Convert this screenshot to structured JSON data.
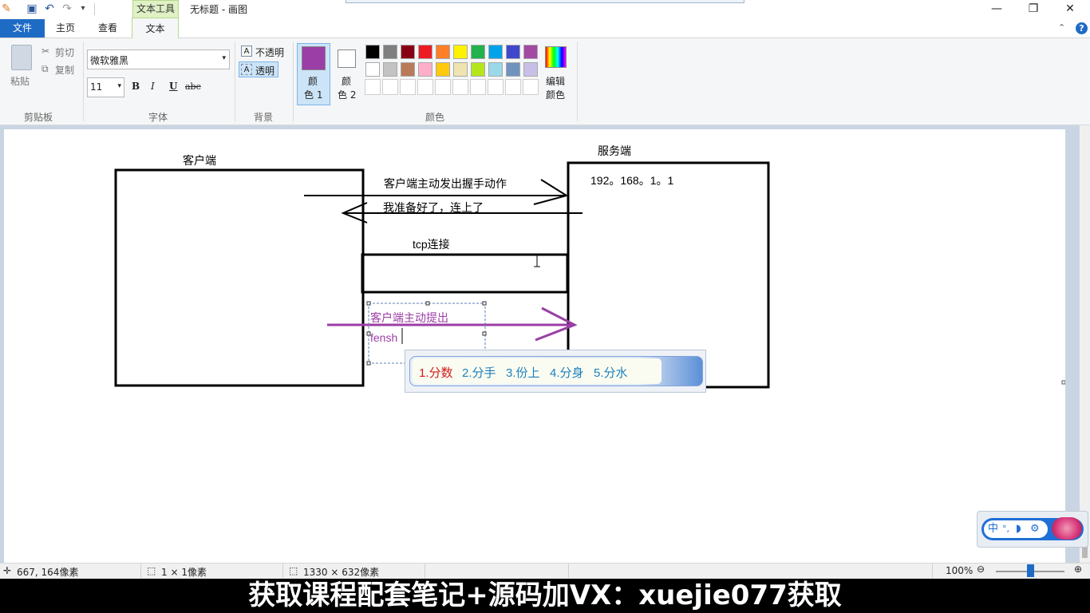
{
  "titlebar": {
    "window_title": "无标题 - 画图",
    "context_tab": "文本工具"
  },
  "tabs": {
    "file": "文件",
    "home": "主页",
    "view": "查看",
    "text": "文本"
  },
  "ribbon": {
    "clipboard": {
      "paste": "粘贴",
      "cut": "剪切",
      "copy": "复制",
      "group_label": "剪贴板"
    },
    "font": {
      "family": "微软雅黑",
      "size": "11",
      "bold": "B",
      "italic": "I",
      "underline": "U",
      "strike": "abc",
      "group_label": "字体"
    },
    "background": {
      "opaque": "不透明",
      "transparent": "透明",
      "group_label": "背景"
    },
    "colors": {
      "color1_label_a": "颜",
      "color1_label_b": "色 1",
      "color2_label_a": "颜",
      "color2_label_b": "色 2",
      "color1_value": "#9b3ea5",
      "color2_value": "#ffffff",
      "edit_a": "编辑",
      "edit_b": "颜色",
      "group_label": "颜色",
      "palette_row1": [
        "#000000",
        "#7f7f7f",
        "#880015",
        "#ed1c24",
        "#ff7f27",
        "#fff200",
        "#22b14c",
        "#00a2e8",
        "#3f48cc",
        "#a349a4"
      ],
      "palette_row2": [
        "#ffffff",
        "#c3c3c3",
        "#b97a57",
        "#ffaec9",
        "#ffc90e",
        "#efe4b0",
        "#b5e61d",
        "#99d9ea",
        "#7092be",
        "#c8bfe7"
      ]
    }
  },
  "canvas": {
    "client_label": "客户端",
    "server_label": "服务端",
    "server_ip": "192。168。1。1",
    "handshake_label": "客户端主动发出握手动作",
    "ready_label": "我准备好了，连上了",
    "tcp_label": "tcp连接",
    "editing_line1": "客户端主动提出",
    "editing_line2": "fensh"
  },
  "ime": {
    "candidates": [
      "1.分数",
      "2.分手",
      "3.份上",
      "4.分身",
      "5.分水"
    ],
    "status_mode": "中"
  },
  "statusbar": {
    "cursor_pos": "667, 164像素",
    "selection_size": "1 × 1像素",
    "image_size": "1330 × 632像素",
    "zoom": "100%",
    "zoom_level": 1.0
  },
  "banner": {
    "text": "获取课程配套笔记+源码加VX：xuejie077获取"
  }
}
